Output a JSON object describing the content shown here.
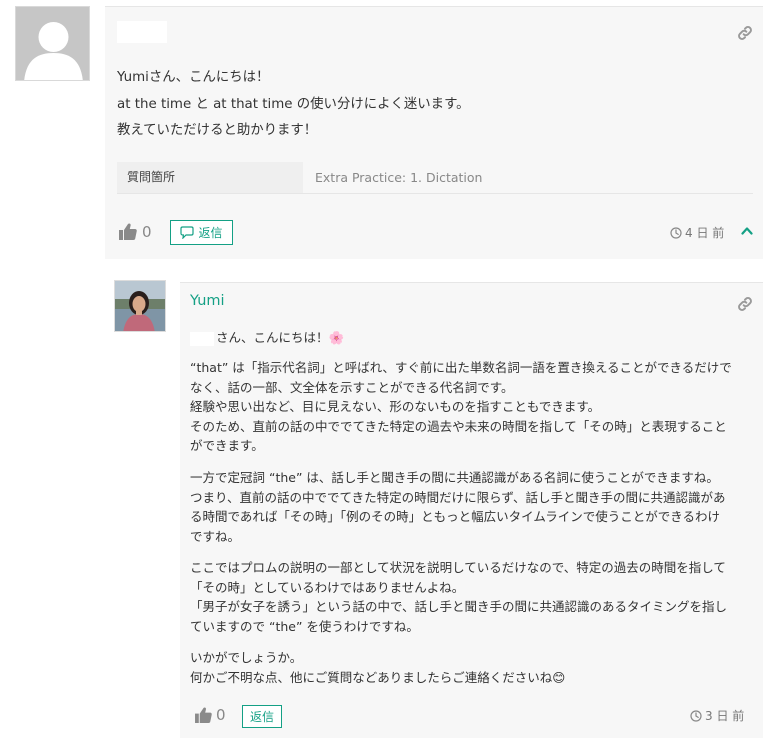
{
  "question": {
    "lines": [
      "Yumiさん、こんにちは！",
      "at the time と at that time の使い分けによく迷います。",
      "教えていただけると助かります！"
    ],
    "meta_label": "質問箇所",
    "meta_value": "Extra Practice: 1. Dictation",
    "like_count": "0",
    "reply_label": "返信",
    "time_ago": "4 日 前"
  },
  "reply": {
    "author": "Yumi",
    "greeting": "さん、こんにちは！🌸",
    "paragraphs": [
      [
        "“that” は「指示代名詞」と呼ばれ、すぐ前に出た単数名詞一語を置き換えることができるだけで",
        "なく、話の一部、文全体を示すことができる代名詞です。",
        "経験や思い出など、目に見えない、形のないものを指すこともできます。",
        "そのため、直前の話の中ででてきた特定の過去や未来の時間を指して「その時」と表現すること",
        "ができます。"
      ],
      [
        "一方で定冠詞 “the” は、話し手と聞き手の間に共通認識がある名詞に使うことができますね。",
        "つまり、直前の話の中ででてきた特定の時間だけに限らず、話し手と聞き手の間に共通認識があ",
        "る時間であれば「その時」「例のその時」ともっと幅広いタイムラインで使うことができるわけ",
        "ですね。"
      ],
      [
        "ここではプロムの説明の一部として状況を説明しているだけなので、特定の過去の時間を指して",
        "「その時」としているわけではありませんよね。",
        "「男子が女子を誘う」という話の中で、話し手と聞き手の間に共通認識のあるタイミングを指し",
        "ていますので “the” を使うわけですね。"
      ],
      [
        "いかがでしょうか。",
        "何かご不明な点、他にご質問などありましたらご連絡くださいね😊"
      ]
    ],
    "like_count": "0",
    "reply_label": "返信",
    "time_ago": "3 日 前"
  },
  "colors": {
    "accent": "#14a085",
    "card_bg": "#f7f7f7"
  }
}
